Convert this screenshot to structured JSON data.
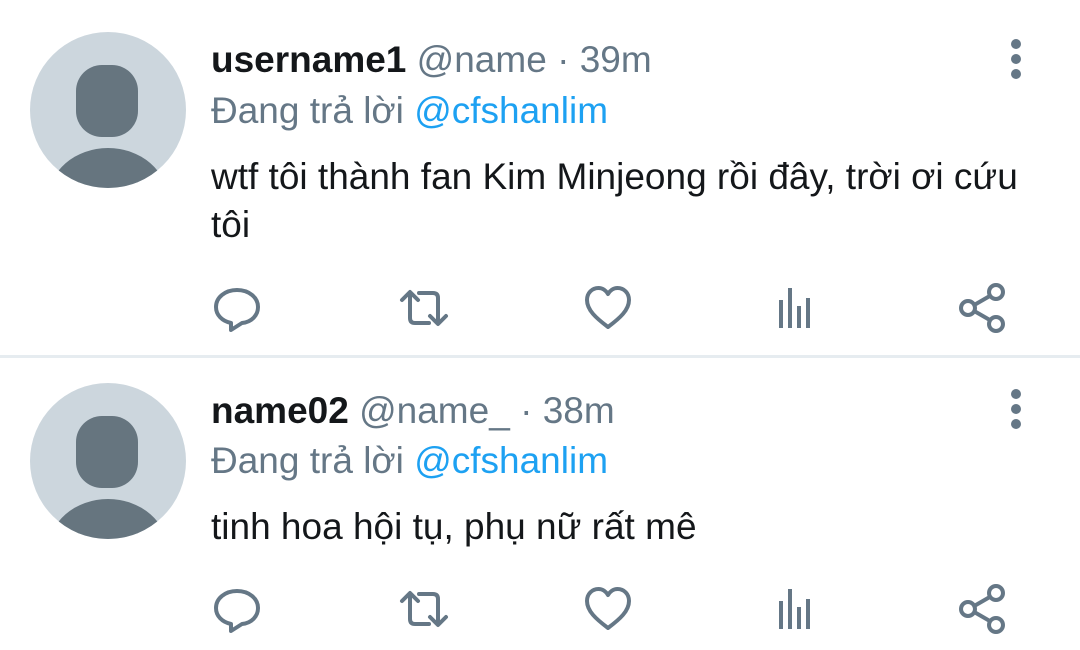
{
  "tweets": [
    {
      "display_name": "username1",
      "handle": "@name",
      "separator": " · ",
      "time": "39m",
      "reply_prefix": "Đang trả lời ",
      "reply_to": "@cfshanlim",
      "text": "wtf tôi thành fan Kim Minjeong rồi đây, trời ơi cứu tôi"
    },
    {
      "display_name": "name02",
      "handle": "@name_",
      "separator": " · ",
      "time": "38m",
      "reply_prefix": "Đang trả lời ",
      "reply_to": "@cfshanlim",
      "text": "tinh hoa hội tụ, phụ nữ rất mê"
    }
  ],
  "icons": {
    "avatar": "default-avatar-icon",
    "more": "more-vertical-icon",
    "reply": "reply-icon",
    "retweet": "retweet-icon",
    "like": "heart-icon",
    "stats": "analytics-icon",
    "share": "share-icon"
  },
  "colors": {
    "text": "#14171a",
    "secondary": "#657786",
    "link": "#1da1f2",
    "avatar_bg": "#ccd6dd",
    "avatar_fg": "#66757f",
    "divider": "#e6ecf0"
  }
}
